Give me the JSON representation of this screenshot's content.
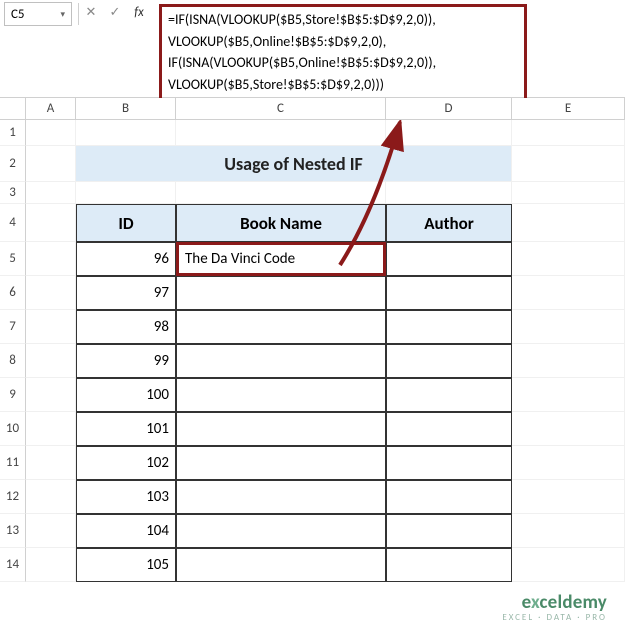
{
  "nameBox": {
    "cellRef": "C5"
  },
  "formula": {
    "l1": "=IF(ISNA(VLOOKUP($B5,Store!$B$5:$D$9,2,0)),",
    "l2": "VLOOKUP($B5,Online!$B$5:$D$9,2,0),",
    "l3": "IF(ISNA(VLOOKUP($B5,Online!$B$5:$D$9,2,0)),",
    "l4": "VLOOKUP($B5,Store!$B$5:$D$9,2,0)))"
  },
  "columns": {
    "A": "A",
    "B": "B",
    "C": "C",
    "D": "D",
    "E": "E"
  },
  "rows": {
    "r1": "1",
    "r2": "2",
    "r3": "3",
    "r4": "4",
    "r5": "5",
    "r6": "6",
    "r7": "7",
    "r8": "8",
    "r9": "9",
    "r10": "10",
    "r11": "11",
    "r12": "12",
    "r13": "13",
    "r14": "14"
  },
  "title": "Usage of Nested IF",
  "headers": {
    "id": "ID",
    "book": "Book Name",
    "author": "Author"
  },
  "data": {
    "ids": {
      "r5": "96",
      "r6": "97",
      "r7": "98",
      "r8": "99",
      "r9": "100",
      "r10": "101",
      "r11": "102",
      "r12": "103",
      "r13": "104",
      "r14": "105"
    },
    "c5": "The Da Vinci Code"
  },
  "watermark": {
    "brand_pre": "e",
    "brand_x": "x",
    "brand_post": "celdemy",
    "tag": "EXCEL · DATA · PRO"
  }
}
